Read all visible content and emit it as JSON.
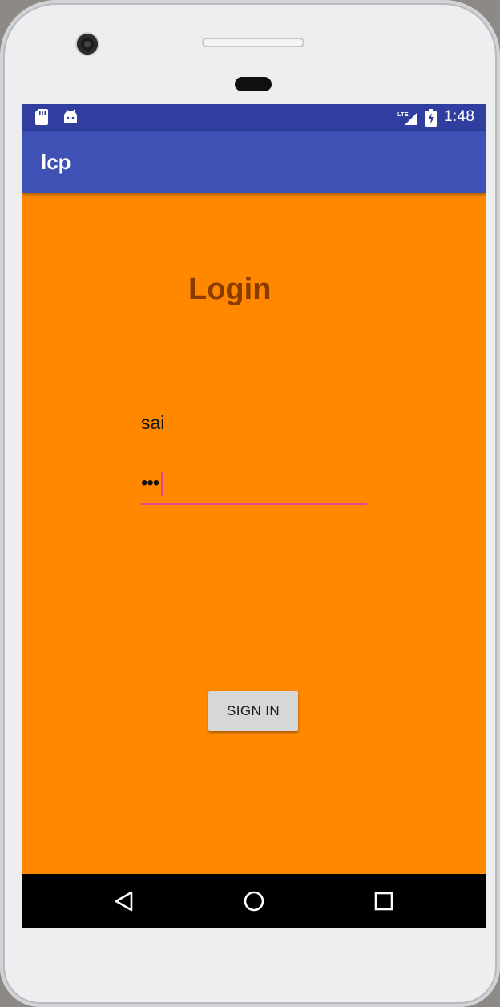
{
  "status_bar": {
    "time": "1:48",
    "icons": [
      "sd-card-icon",
      "android-icon",
      "lte-signal-icon",
      "battery-charging-icon"
    ]
  },
  "app_bar": {
    "title": "lcp"
  },
  "login": {
    "heading": "Login",
    "username_value": "sai",
    "password_value": "•••",
    "sign_in_label": "SIGN IN"
  },
  "nav_bar": {
    "icons": [
      "back-icon",
      "home-icon",
      "recents-icon"
    ]
  },
  "colors": {
    "background": "#ff8800",
    "status_bar": "#303f9f",
    "app_bar": "#3f51b5",
    "heading": "#8a3c00",
    "accent": "#e8458f",
    "button": "#d6d7d7"
  }
}
